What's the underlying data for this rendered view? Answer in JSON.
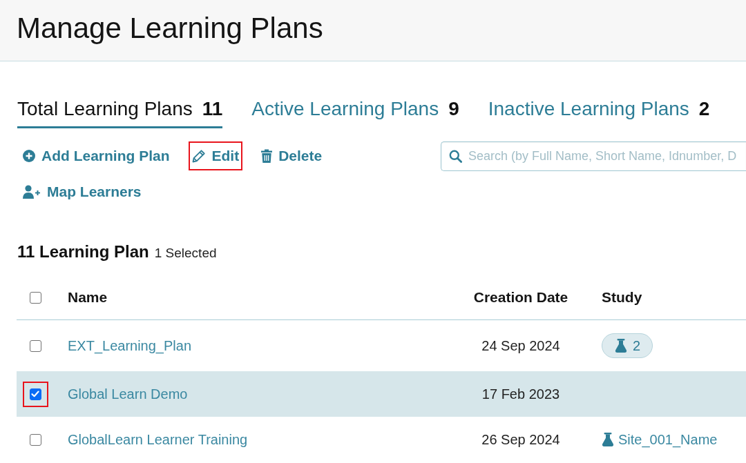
{
  "header": {
    "title": "Manage Learning Plans"
  },
  "tabs": [
    {
      "label": "Total Learning Plans",
      "count": "11",
      "selected": true
    },
    {
      "label": "Active Learning Plans",
      "count": "9",
      "selected": false
    },
    {
      "label": "Inactive Learning Plans",
      "count": "2",
      "selected": false
    }
  ],
  "actions": [
    {
      "kind": "add",
      "label": "Add Learning Plan",
      "highlighted": false
    },
    {
      "kind": "edit",
      "label": "Edit",
      "highlighted": true
    },
    {
      "kind": "delete",
      "label": "Delete",
      "highlighted": false
    },
    {
      "kind": "map",
      "label": "Map Learners",
      "highlighted": false
    }
  ],
  "search": {
    "placeholder": "Search (by Full Name, Short Name, Idnumber, D"
  },
  "summary": {
    "total": "11 Learning Plan",
    "selected": "1 Selected"
  },
  "table": {
    "select_all_checked": false,
    "columns": [
      "Name",
      "Creation Date",
      "Study"
    ],
    "rows": [
      {
        "name": "EXT_Learning_Plan",
        "date": "24 Sep 2024",
        "study": {
          "kind": "count",
          "text": "2"
        },
        "selected": false,
        "highlighted": false
      },
      {
        "name": "Global Learn Demo",
        "date": "17 Feb 2023",
        "selected": true,
        "highlighted": true
      },
      {
        "name": "GlobalLearn Learner Training",
        "date": "26 Sep 2024",
        "study": {
          "kind": "site",
          "text": "Site_001_Name"
        },
        "selected": false,
        "highlighted": false
      }
    ]
  }
}
